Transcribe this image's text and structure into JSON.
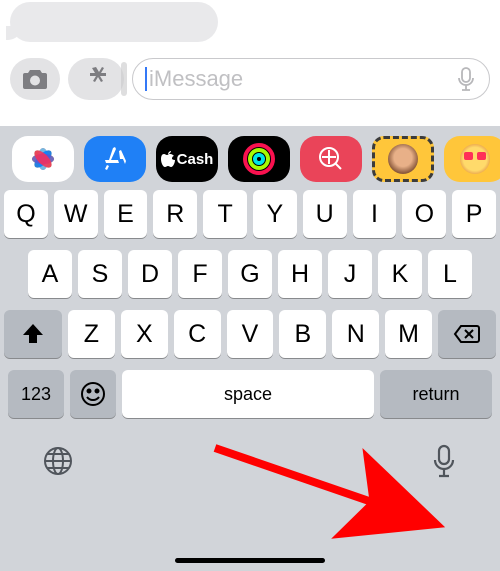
{
  "input": {
    "placeholder": "iMessage"
  },
  "apps": {
    "cash_label": "Cash"
  },
  "keys": {
    "row1": [
      "Q",
      "W",
      "E",
      "R",
      "T",
      "Y",
      "U",
      "I",
      "O",
      "P"
    ],
    "row2": [
      "A",
      "S",
      "D",
      "F",
      "G",
      "H",
      "J",
      "K",
      "L"
    ],
    "row3": [
      "Z",
      "X",
      "C",
      "V",
      "B",
      "N",
      "M"
    ]
  },
  "bottom": {
    "numbers": "123",
    "space": "space",
    "return": "return"
  }
}
